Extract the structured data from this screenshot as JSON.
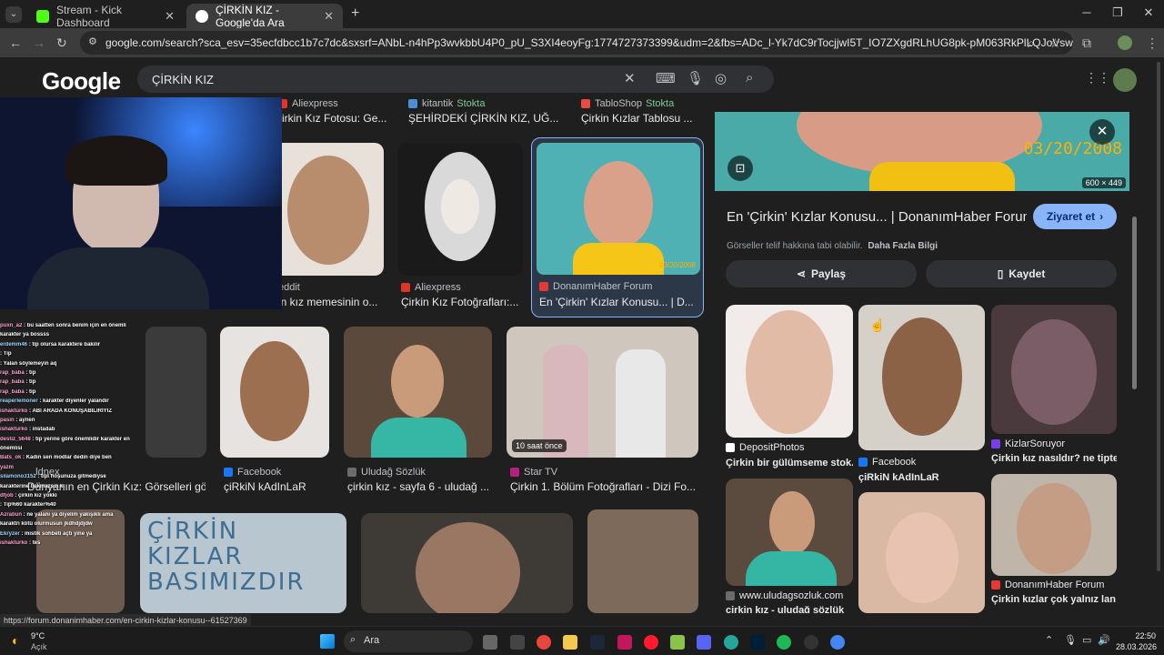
{
  "browser": {
    "tabs": [
      {
        "title": "Stream - Kick Dashboard",
        "favicon_color": "#53fc18"
      },
      {
        "title": "ÇİRKİN KIZ - Google'da Ara",
        "favicon_color": "#4285f4"
      }
    ],
    "url": "google.com/search?sca_esv=35ecfdbcc1b7c7dc&sxsrf=ANbL-n4hPp3wvkbbU4P0_pU_S3XI4eoyFg:1774727373399&udm=2&fbs=ADc_l-Yk7dC9rTocjjwI5T_IO7ZXgdRLhUG8pk-pM063RkPlLQJoVswXu7XoIdd5UH6fMIoUD..."
  },
  "google": {
    "logo": "Google",
    "query": "ÇİRKİN KIZ"
  },
  "results": [
    {
      "source": "Aliexpress",
      "title": "irkin Kız Fotosu: Ge..."
    },
    {
      "source": "kitantik",
      "badge": "Stokta",
      "title": "ŞEHİRDEKİ ÇİRKİN KIZ, UĞ..."
    },
    {
      "source": "TabloShop",
      "badge": "Stokta",
      "title": "Çirkin Kızlar Tablosu ..."
    },
    {
      "source": "eddit",
      "title": "in kız memesinin o..."
    },
    {
      "source": "Aliexpress",
      "title": "Çirkin Kız Fotoğrafları:..."
    },
    {
      "source": "DonanımHaber Forum",
      "title": "En 'Çirkin' Kızlar Konusu... | D...",
      "date": "03/20/2008"
    },
    {
      "source": "...ldnex",
      "title": "Dünyanın en Çirkin Kız: Görselleri gö..."
    },
    {
      "source": "Facebook",
      "title": "çiRkiN kAdInLaR"
    },
    {
      "source": "Uludağ Sözlük",
      "title": "çirkin kız - sayfa 6 - uludağ ..."
    },
    {
      "source": "Star TV",
      "title": "Çirkin 1. Bölüm Fotoğrafları - Dizi Fo...",
      "time_badge": "10 saat önce"
    }
  ],
  "bottom_row_text": "ÇİRKİN KIZLAR BASIMIZDIR",
  "panel": {
    "date_stamp": "03/20/2008",
    "dimensions": "600 × 449",
    "title": "En 'Çirkin' Kızlar Konusu... | DonanımHaber Forum",
    "visit_button": "Ziyaret et",
    "copyright_note": "Görseller telif hakkına tabi olabilir.",
    "more_info": "Daha Fazla Bilgi",
    "share_button": "Paylaş",
    "save_button": "Kaydet",
    "related": [
      {
        "source": "DepositPhotos",
        "title": "Çirkin bir gülümseme stok..."
      },
      {
        "source": "Facebook",
        "title": "çiRkiN kAdInLaR"
      },
      {
        "source": "KizlarSoruyor",
        "title": "Çirkin kız nasıldır? ne tiptek..."
      },
      {
        "source": "www.uludagsozluk.com",
        "title": "çirkin kız - uludağ sözlük"
      },
      {
        "source": "DonanımHaber Forum",
        "title": "Çirkin kızlar çok yalnız lan |..."
      }
    ]
  },
  "chat": [
    {
      "user": "puxn_a2",
      "msg": "bu saatten sonra benim için en önemli"
    },
    {
      "user": "",
      "msg": "karakter ya bossss"
    },
    {
      "user": "erdemm46",
      "msg": "tip olursa karaktere bakılır"
    },
    {
      "user": "",
      "msg": "Tip"
    },
    {
      "user": "",
      "msg": "Yalan söylemeyin aq"
    },
    {
      "user": "rap_baba",
      "msg": "tip"
    },
    {
      "user": "rap_baba",
      "msg": "tip"
    },
    {
      "user": "rap_baba",
      "msg": "tip"
    },
    {
      "user": "reaperlemoner",
      "msg": "karakter diyenler yalandır"
    },
    {
      "user": "ishakturko",
      "msg": "ABİ ARADA KONUŞABİLİRİYİZ"
    },
    {
      "user": "pasin",
      "msg": "aynen"
    },
    {
      "user": "ishakturko",
      "msg": "instadab"
    },
    {
      "user": "destiz_5648",
      "msg": "tip yerine göre önemlidir karakter en"
    },
    {
      "user": "",
      "msg": "önemlisi"
    },
    {
      "user": "Bats_ok",
      "msg": "Kadın sen modlar dedin diye ben"
    },
    {
      "user": "yazm",
      "msg": ""
    },
    {
      "user": "silamono3152",
      "msg": "tipi hoşunuza gitmediyse"
    },
    {
      "user": "",
      "msg": "karakterine bakmazsın ki"
    },
    {
      "user": "dfjob",
      "msg": "çirkin kız yokki"
    },
    {
      "user": "",
      "msg": "Tip%60 karakter%40"
    },
    {
      "user": "Azrabun",
      "msg": "ne yalanı ya diyelim yakışıklı ama"
    },
    {
      "user": "",
      "msg": "karaktri kötü olurmusun jkdhdjdjdw"
    },
    {
      "user": "Ekryzer",
      "msg": "mistik sohbeti açtı yine ya"
    },
    {
      "user": "ishakturko",
      "msg": "tes"
    }
  ],
  "status_url": "https://forum.donanimhaber.com/en-cirkin-kizlar-konusu--61527369",
  "taskbar": {
    "weather_temp": "9°C",
    "weather_desc": "Açık",
    "search_label": "Ara",
    "time": "22:50",
    "date": "28.03.2026"
  }
}
